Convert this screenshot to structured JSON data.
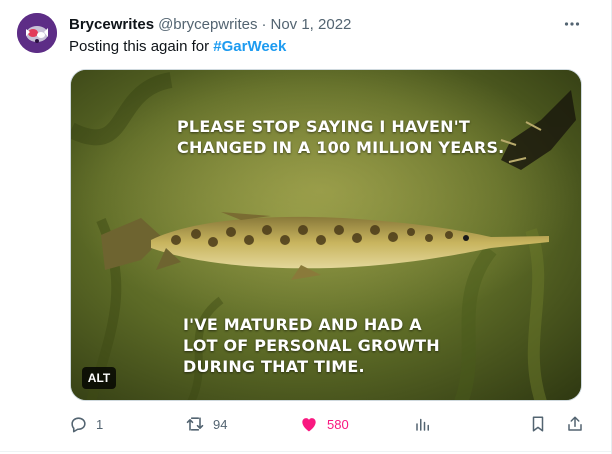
{
  "tweet": {
    "display_name": "Brycewrites",
    "handle": "@brycepwrites",
    "separator": "·",
    "date": "Nov 1, 2022",
    "text_prefix": "Posting this again for ",
    "hashtag": "#GarWeek"
  },
  "media": {
    "caption_top": "PLEASE STOP SAYING I HAVEN'T\nCHANGED IN A 100 MILLION YEARS.",
    "caption_bottom": "I'VE MATURED AND HAD A\nLOT OF PERSONAL GROWTH\nDURING THAT TIME.",
    "alt_label": "ALT"
  },
  "actions": {
    "reply_count": "1",
    "retweet_count": "94",
    "like_count": "580",
    "like_color": "#f91880",
    "icons": [
      "reply-icon",
      "retweet-icon",
      "heart-icon",
      "views-icon",
      "bookmark-icon",
      "share-icon"
    ]
  },
  "colors": {
    "accent": "#1d9bf0",
    "muted_text": "#536471",
    "avatar_bg": "#5d2d86"
  }
}
